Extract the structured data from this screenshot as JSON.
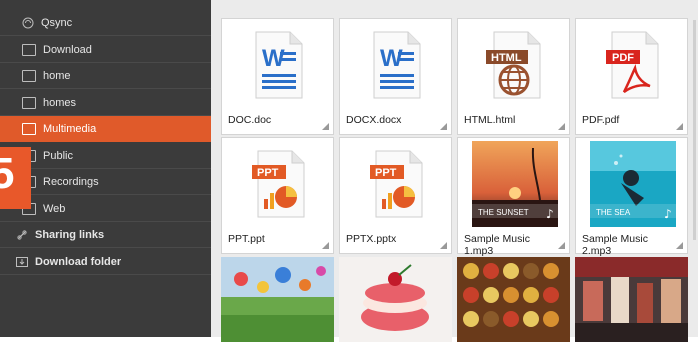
{
  "sidebar": {
    "items": [
      {
        "label": "Qsync"
      },
      {
        "label": "Download"
      },
      {
        "label": "home"
      },
      {
        "label": "homes"
      },
      {
        "label": "Multimedia"
      },
      {
        "label": "Public"
      },
      {
        "label": "Recordings"
      },
      {
        "label": "Web"
      },
      {
        "label": "Sharing links"
      },
      {
        "label": "Download folder"
      }
    ],
    "badge_text": "5",
    "accent": "#e05a2a"
  },
  "files": [
    {
      "name": "DOC.doc",
      "icon": "word-doc-icon"
    },
    {
      "name": "DOCX.docx",
      "icon": "word-doc-icon"
    },
    {
      "name": "HTML.html",
      "icon": "html-globe-icon"
    },
    {
      "name": "PDF.pdf",
      "icon": "pdf-icon"
    },
    {
      "name": "PPT.ppt",
      "icon": "ppt-icon"
    },
    {
      "name": "PPTX.pptx",
      "icon": "ppt-icon"
    },
    {
      "name": "Sample Music 1.mp3",
      "thumb_text": "THE SUNSET"
    },
    {
      "name": "Sample Music 2.mp3",
      "thumb_text": "THE SEA"
    }
  ],
  "icon_text": {
    "word": "W",
    "html": "HTML",
    "pdf": "PDF",
    "ppt": "PPT"
  }
}
